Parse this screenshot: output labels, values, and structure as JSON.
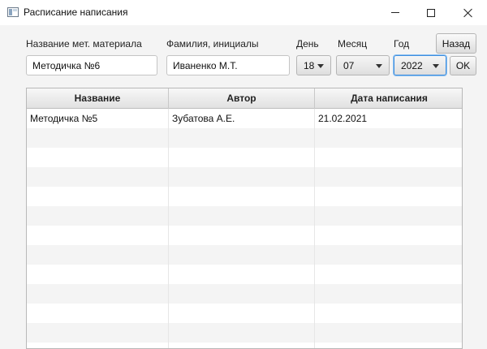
{
  "window": {
    "title": "Расписание написания"
  },
  "form": {
    "material_label": "Название мет. материала",
    "material_value": "Методичка №6",
    "author_label": "Фамилия, инициалы",
    "author_value": "Иваненко М.Т.",
    "day_label": "День",
    "day_value": "18",
    "month_label": "Месяц",
    "month_value": "07",
    "year_label": "Год",
    "year_value": "2022",
    "back_label": "Назад",
    "ok_label": "OK"
  },
  "table": {
    "columns": [
      "Название",
      "Автор",
      "Дата написания"
    ],
    "rows": [
      [
        "Методичка №5",
        "Зубатова А.Е.",
        "21.02.2021"
      ]
    ]
  },
  "icons": [
    "app-window-icon",
    "minimize-icon",
    "maximize-icon",
    "close-icon",
    "chevron-down-icon"
  ],
  "colors": {
    "focus_border": "#3d8ee0",
    "row_alt": "#f4f4f4"
  }
}
